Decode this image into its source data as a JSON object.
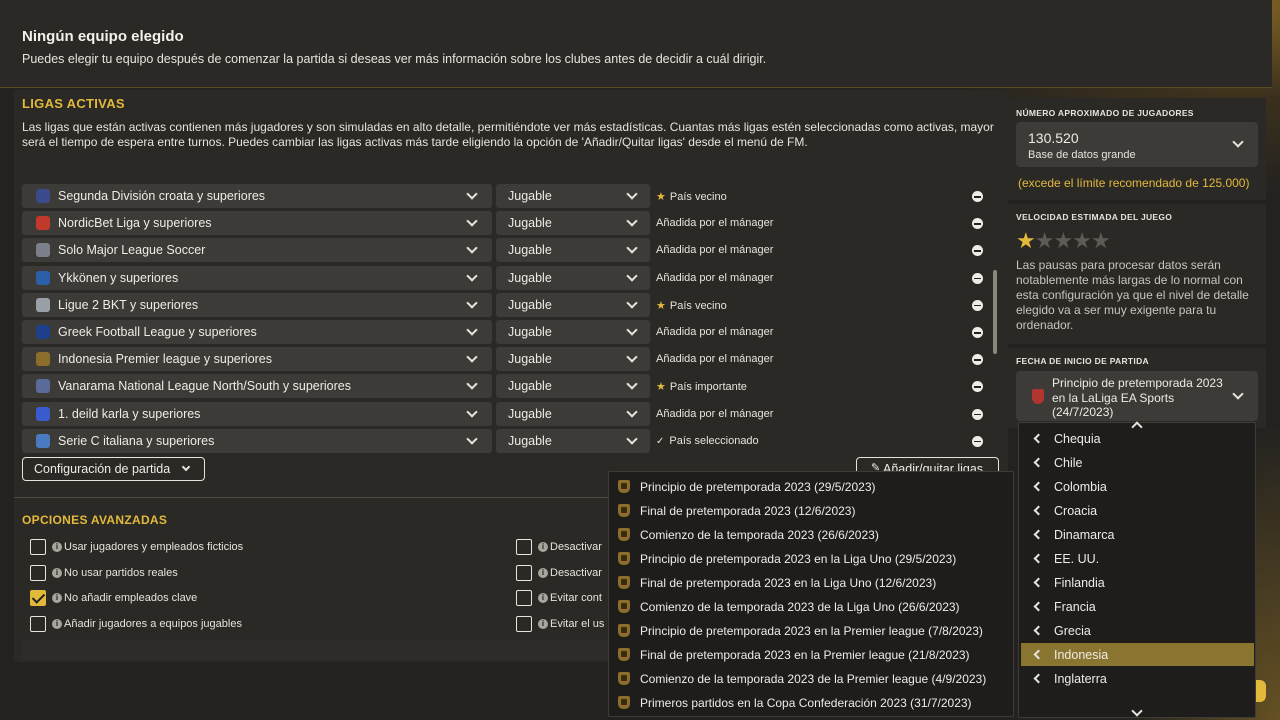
{
  "header": {
    "title": "Ningún equipo elegido",
    "description": "Puedes elegir tu equipo después de comenzar la partida si deseas ver más información sobre los clubes antes de decidir a cuál dirigir."
  },
  "active_leagues": {
    "title": "LIGAS ACTIVAS",
    "description": "Las ligas que están activas contienen más jugadores y son simuladas en alto detalle, permitiéndote ver más estadísticas. Cuantas más ligas estén seleccionadas como activas, mayor será el tiempo de espera entre turnos. Puedes cambiar las ligas activas más tarde eligiendo la opción de 'Añadir/Quitar ligas' desde el menú de FM.",
    "rows": [
      {
        "league": "Segunda División croata y superiores",
        "mode": "Jugable",
        "status": "País vecino",
        "status_icon": "star-icon",
        "icon_color": "#3a4a8a"
      },
      {
        "league": "NordicBet Liga y superiores",
        "mode": "Jugable",
        "status": "Añadida por el mánager",
        "status_icon": "",
        "icon_color": "#c0392b"
      },
      {
        "league": "Solo Major League Soccer",
        "mode": "Jugable",
        "status": "Añadida por el mánager",
        "status_icon": "",
        "icon_color": "#7a7f8a"
      },
      {
        "league": "Ykkönen y superiores",
        "mode": "Jugable",
        "status": "Añadida por el mánager",
        "status_icon": "",
        "icon_color": "#2b5fa8"
      },
      {
        "league": "Ligue 2 BKT y superiores",
        "mode": "Jugable",
        "status": "País vecino",
        "status_icon": "star-icon",
        "icon_color": "#9aa0a8"
      },
      {
        "league": "Greek Football League y superiores",
        "mode": "Jugable",
        "status": "Añadida por el mánager",
        "status_icon": "",
        "icon_color": "#1f3f8a"
      },
      {
        "league": "Indonesia Premier league y superiores",
        "mode": "Jugable",
        "status": "Añadida por el mánager",
        "status_icon": "",
        "icon_color": "#8c6d2c"
      },
      {
        "league": "Vanarama National League North/South y superiores",
        "mode": "Jugable",
        "status": "País importante",
        "status_icon": "star-icon",
        "icon_color": "#5a6a9a"
      },
      {
        "league": "1. deild karla y superiores",
        "mode": "Jugable",
        "status": "Añadida por el mánager",
        "status_icon": "",
        "icon_color": "#3a5ad0"
      },
      {
        "league": "Serie C italiana y superiores",
        "mode": "Jugable",
        "status": "País seleccionado",
        "status_icon": "check-icon",
        "icon_color": "#4a7ac0"
      }
    ],
    "config_button": "Configuración de partida",
    "add_button": "Añadir/quitar ligas"
  },
  "advanced": {
    "title": "OPCIONES AVANZADAS",
    "left_options": [
      {
        "label": "Usar jugadores y empleados ficticios",
        "checked": false
      },
      {
        "label": "No usar partidos reales",
        "checked": false
      },
      {
        "label": "No añadir empleados clave",
        "checked": true
      },
      {
        "label": "Añadir jugadores a equipos jugables",
        "checked": false
      }
    ],
    "right_options": [
      {
        "label": "Desactivar",
        "checked": false
      },
      {
        "label": "Desactivar",
        "checked": false
      },
      {
        "label": "Evitar cont",
        "checked": false
      },
      {
        "label": "Evitar el us",
        "checked": false
      }
    ]
  },
  "sidebar": {
    "players_heading": "NÚMERO APROXIMADO DE JUGADORES",
    "players_value": "130.520",
    "players_db": "Base de datos grande",
    "players_warning": "(excede el límite recomendado de 125.000)",
    "speed_heading": "VELOCIDAD ESTIMADA DEL JUEGO",
    "speed_rating": 0.5,
    "speed_max": 5,
    "speed_text": "Las pausas para procesar datos serán notablemente más largas de lo normal con esta configuración ya que el nivel de detalle elegido va a ser muy exigente para tu ordenador.",
    "start_heading": "FECHA DE INICIO DE PARTIDA",
    "start_value": "Principio de pretemporada 2023 en la LaLiga EA Sports (24/7/2023)"
  },
  "country_dropdown": {
    "items": [
      "Chequia",
      "Chile",
      "Colombia",
      "Croacia",
      "Dinamarca",
      "EE. UU.",
      "Finlandia",
      "Francia",
      "Grecia",
      "Indonesia",
      "Inglaterra"
    ],
    "selected": "Indonesia"
  },
  "date_dropdown": {
    "items": [
      "Principio de pretemporada 2023 (29/5/2023)",
      "Final de pretemporada 2023 (12/6/2023)",
      "Comienzo de la temporada 2023 (26/6/2023)",
      "Principio de pretemporada 2023 en la Liga Uno (29/5/2023)",
      "Final de pretemporada 2023 en la Liga Uno (12/6/2023)",
      "Comienzo de la temporada 2023 de la Liga Uno (26/6/2023)",
      "Principio de pretemporada 2023 en la Premier league (7/8/2023)",
      "Final de pretemporada 2023 en la Premier league (21/8/2023)",
      "Comienzo de la temporada 2023 de la Premier league (4/9/2023)",
      "Primeros partidos en la Copa Confederación 2023 (31/7/2023)"
    ]
  },
  "colors": {
    "accent": "#e3b93c",
    "background": "#232220",
    "panel": "#2a2926",
    "control": "#3c3b38",
    "selected_row": "#8a7530"
  }
}
